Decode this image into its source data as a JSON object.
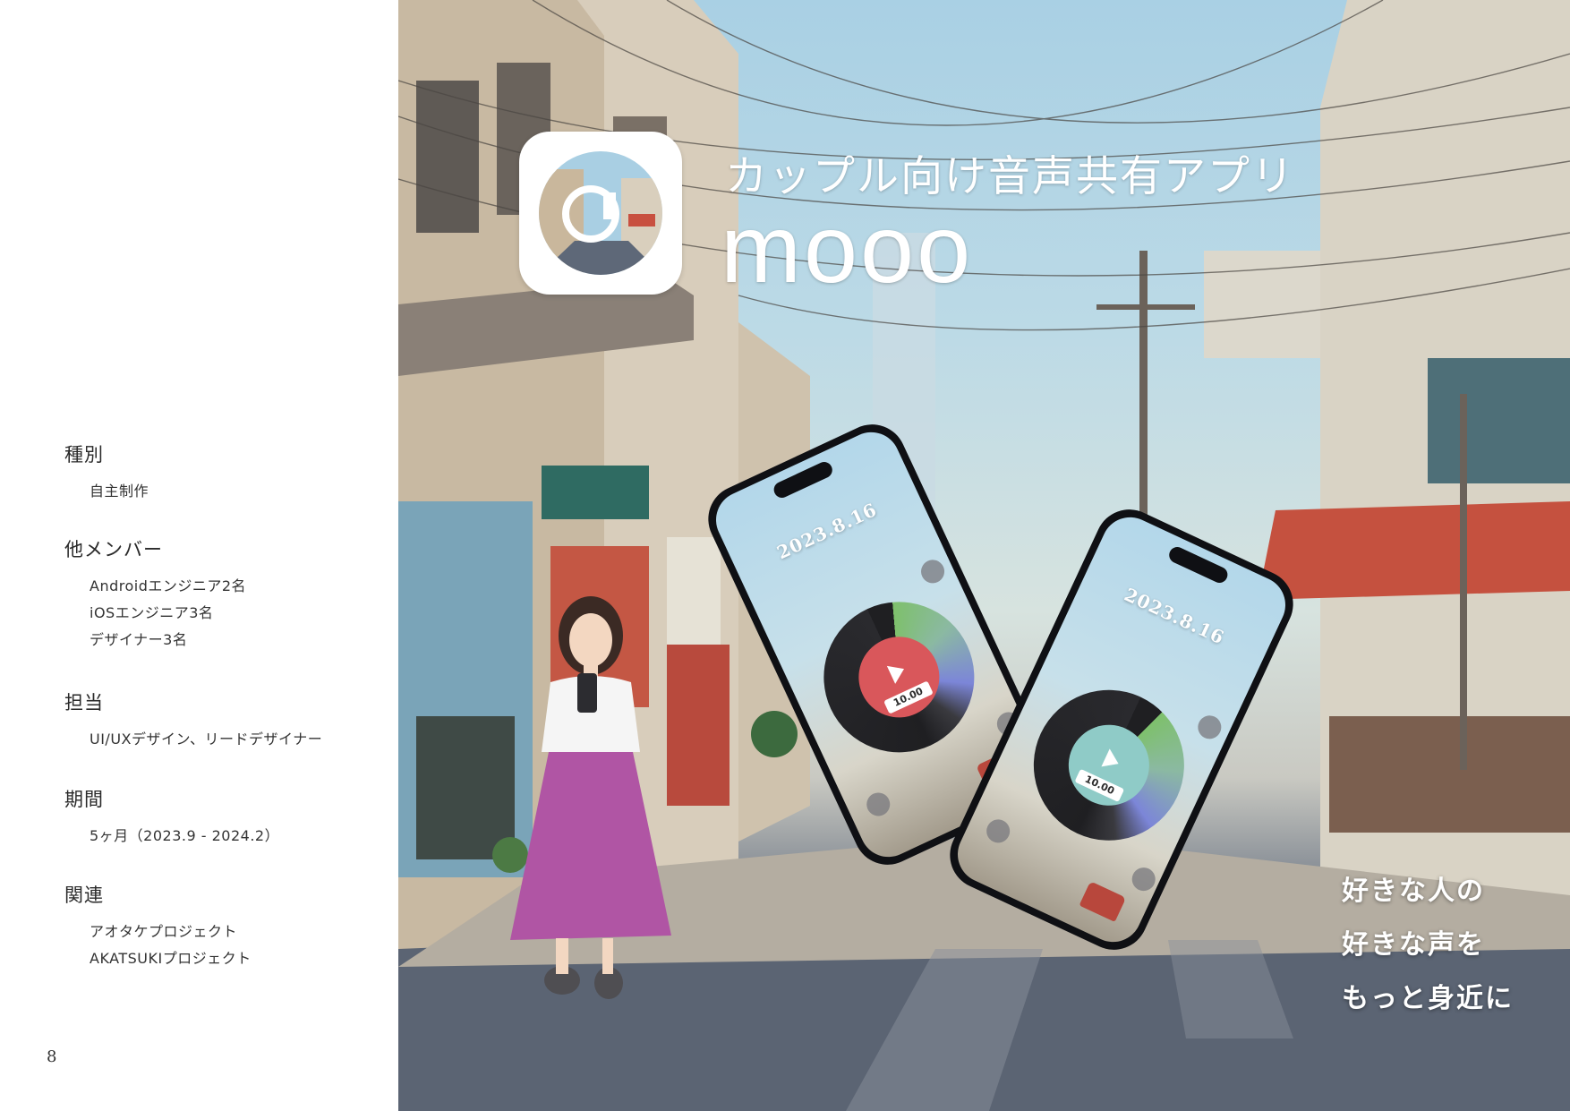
{
  "info": {
    "sections": [
      {
        "title": "種別",
        "items": [
          "自主制作"
        ]
      },
      {
        "title": "他メンバー",
        "items": [
          "Androidエンジニア2名",
          "iOSエンジニア3名",
          "デザイナー3名"
        ]
      },
      {
        "title": "担当",
        "items": [
          "UI/UXデザイン、リードデザイナー"
        ]
      },
      {
        "title": "期間",
        "items": [
          "5ヶ月（2023.9 - 2024.2）"
        ]
      },
      {
        "title": "関連",
        "items": [
          "アオタケプロジェクト",
          "AKATSUKIプロジェクト"
        ]
      }
    ],
    "page_number": "8"
  },
  "poster": {
    "tagline": "カップル向け音声共有アプリ",
    "app_name": "mooo",
    "catchcopy": [
      "好きな人の",
      "好きな声を",
      "もっと身近に"
    ],
    "phones": [
      {
        "date": "2023.8.16",
        "time": "10.00",
        "label_color": "#d9575b"
      },
      {
        "date": "2023.8.16",
        "time": "10.00",
        "label_color": "#8fcbc7"
      }
    ]
  }
}
